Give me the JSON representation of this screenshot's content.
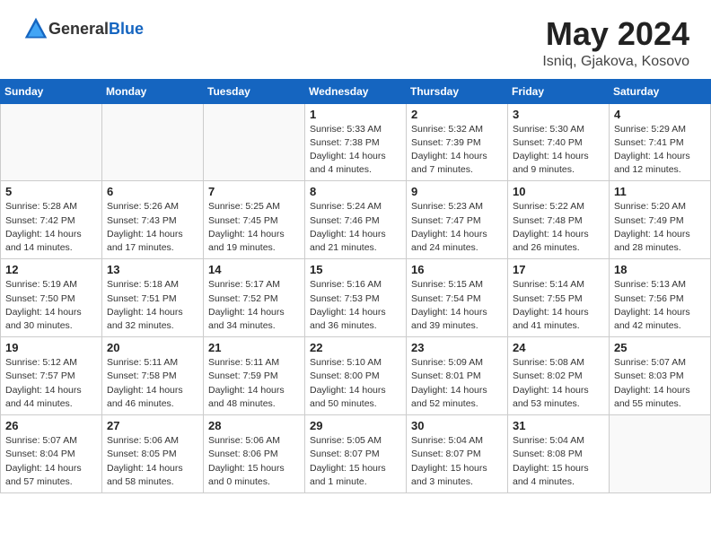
{
  "header": {
    "logo_general": "General",
    "logo_blue": "Blue",
    "month_year": "May 2024",
    "location": "Isniq, Gjakova, Kosovo"
  },
  "weekdays": [
    "Sunday",
    "Monday",
    "Tuesday",
    "Wednesday",
    "Thursday",
    "Friday",
    "Saturday"
  ],
  "weeks": [
    [
      {
        "day": "",
        "info": ""
      },
      {
        "day": "",
        "info": ""
      },
      {
        "day": "",
        "info": ""
      },
      {
        "day": "1",
        "info": "Sunrise: 5:33 AM\nSunset: 7:38 PM\nDaylight: 14 hours\nand 4 minutes."
      },
      {
        "day": "2",
        "info": "Sunrise: 5:32 AM\nSunset: 7:39 PM\nDaylight: 14 hours\nand 7 minutes."
      },
      {
        "day": "3",
        "info": "Sunrise: 5:30 AM\nSunset: 7:40 PM\nDaylight: 14 hours\nand 9 minutes."
      },
      {
        "day": "4",
        "info": "Sunrise: 5:29 AM\nSunset: 7:41 PM\nDaylight: 14 hours\nand 12 minutes."
      }
    ],
    [
      {
        "day": "5",
        "info": "Sunrise: 5:28 AM\nSunset: 7:42 PM\nDaylight: 14 hours\nand 14 minutes."
      },
      {
        "day": "6",
        "info": "Sunrise: 5:26 AM\nSunset: 7:43 PM\nDaylight: 14 hours\nand 17 minutes."
      },
      {
        "day": "7",
        "info": "Sunrise: 5:25 AM\nSunset: 7:45 PM\nDaylight: 14 hours\nand 19 minutes."
      },
      {
        "day": "8",
        "info": "Sunrise: 5:24 AM\nSunset: 7:46 PM\nDaylight: 14 hours\nand 21 minutes."
      },
      {
        "day": "9",
        "info": "Sunrise: 5:23 AM\nSunset: 7:47 PM\nDaylight: 14 hours\nand 24 minutes."
      },
      {
        "day": "10",
        "info": "Sunrise: 5:22 AM\nSunset: 7:48 PM\nDaylight: 14 hours\nand 26 minutes."
      },
      {
        "day": "11",
        "info": "Sunrise: 5:20 AM\nSunset: 7:49 PM\nDaylight: 14 hours\nand 28 minutes."
      }
    ],
    [
      {
        "day": "12",
        "info": "Sunrise: 5:19 AM\nSunset: 7:50 PM\nDaylight: 14 hours\nand 30 minutes."
      },
      {
        "day": "13",
        "info": "Sunrise: 5:18 AM\nSunset: 7:51 PM\nDaylight: 14 hours\nand 32 minutes."
      },
      {
        "day": "14",
        "info": "Sunrise: 5:17 AM\nSunset: 7:52 PM\nDaylight: 14 hours\nand 34 minutes."
      },
      {
        "day": "15",
        "info": "Sunrise: 5:16 AM\nSunset: 7:53 PM\nDaylight: 14 hours\nand 36 minutes."
      },
      {
        "day": "16",
        "info": "Sunrise: 5:15 AM\nSunset: 7:54 PM\nDaylight: 14 hours\nand 39 minutes."
      },
      {
        "day": "17",
        "info": "Sunrise: 5:14 AM\nSunset: 7:55 PM\nDaylight: 14 hours\nand 41 minutes."
      },
      {
        "day": "18",
        "info": "Sunrise: 5:13 AM\nSunset: 7:56 PM\nDaylight: 14 hours\nand 42 minutes."
      }
    ],
    [
      {
        "day": "19",
        "info": "Sunrise: 5:12 AM\nSunset: 7:57 PM\nDaylight: 14 hours\nand 44 minutes."
      },
      {
        "day": "20",
        "info": "Sunrise: 5:11 AM\nSunset: 7:58 PM\nDaylight: 14 hours\nand 46 minutes."
      },
      {
        "day": "21",
        "info": "Sunrise: 5:11 AM\nSunset: 7:59 PM\nDaylight: 14 hours\nand 48 minutes."
      },
      {
        "day": "22",
        "info": "Sunrise: 5:10 AM\nSunset: 8:00 PM\nDaylight: 14 hours\nand 50 minutes."
      },
      {
        "day": "23",
        "info": "Sunrise: 5:09 AM\nSunset: 8:01 PM\nDaylight: 14 hours\nand 52 minutes."
      },
      {
        "day": "24",
        "info": "Sunrise: 5:08 AM\nSunset: 8:02 PM\nDaylight: 14 hours\nand 53 minutes."
      },
      {
        "day": "25",
        "info": "Sunrise: 5:07 AM\nSunset: 8:03 PM\nDaylight: 14 hours\nand 55 minutes."
      }
    ],
    [
      {
        "day": "26",
        "info": "Sunrise: 5:07 AM\nSunset: 8:04 PM\nDaylight: 14 hours\nand 57 minutes."
      },
      {
        "day": "27",
        "info": "Sunrise: 5:06 AM\nSunset: 8:05 PM\nDaylight: 14 hours\nand 58 minutes."
      },
      {
        "day": "28",
        "info": "Sunrise: 5:06 AM\nSunset: 8:06 PM\nDaylight: 15 hours\nand 0 minutes."
      },
      {
        "day": "29",
        "info": "Sunrise: 5:05 AM\nSunset: 8:07 PM\nDaylight: 15 hours\nand 1 minute."
      },
      {
        "day": "30",
        "info": "Sunrise: 5:04 AM\nSunset: 8:07 PM\nDaylight: 15 hours\nand 3 minutes."
      },
      {
        "day": "31",
        "info": "Sunrise: 5:04 AM\nSunset: 8:08 PM\nDaylight: 15 hours\nand 4 minutes."
      },
      {
        "day": "",
        "info": ""
      }
    ]
  ]
}
